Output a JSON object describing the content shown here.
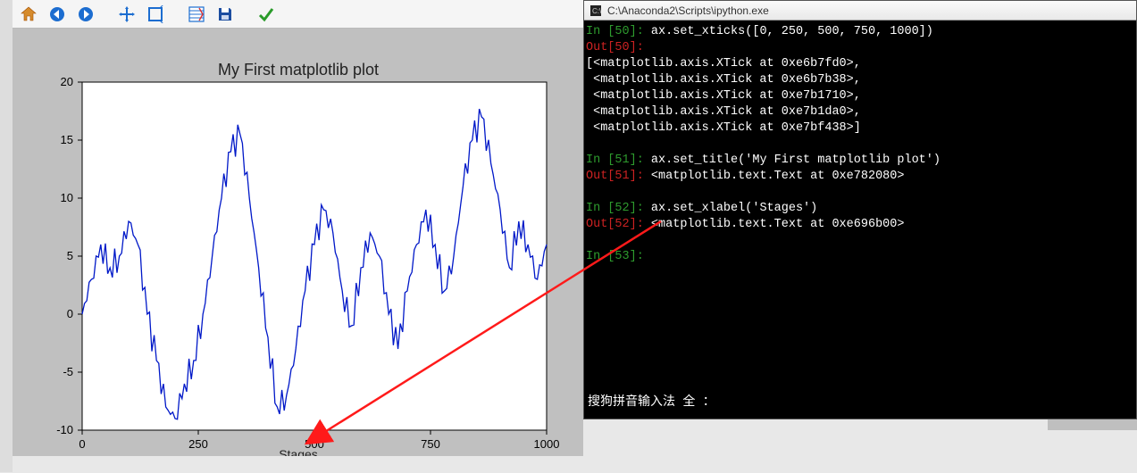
{
  "plot_window": {
    "toolbar_icons": [
      "home",
      "back",
      "forward",
      "pan",
      "zoom",
      "configure",
      "save",
      "check"
    ]
  },
  "chart_data": {
    "type": "line",
    "title": "My First matplotlib plot",
    "xlabel": "Stages",
    "ylabel": "",
    "xlim": [
      0,
      1000
    ],
    "ylim": [
      -10,
      20
    ],
    "yticks": [
      -10,
      -5,
      0,
      5,
      10,
      15,
      20
    ],
    "xticks": [
      0,
      250,
      500,
      750,
      1000
    ],
    "x": [
      0,
      20,
      40,
      60,
      80,
      100,
      120,
      140,
      160,
      180,
      200,
      220,
      240,
      260,
      280,
      300,
      320,
      340,
      360,
      380,
      400,
      420,
      440,
      460,
      480,
      500,
      520,
      540,
      560,
      580,
      600,
      620,
      640,
      660,
      680,
      700,
      720,
      740,
      760,
      780,
      800,
      820,
      840,
      860,
      880,
      900,
      920,
      940,
      960,
      980,
      1000
    ],
    "values": [
      0,
      3,
      6,
      4,
      5,
      8,
      6,
      0,
      -4,
      -8,
      -9,
      -6,
      -4,
      0,
      5,
      10,
      14,
      15.5,
      10,
      4,
      -2,
      -8,
      -7,
      -3,
      2,
      6,
      9,
      7,
      2,
      -1,
      4,
      7,
      5,
      0,
      -3,
      2,
      6,
      9,
      6,
      2,
      5,
      11,
      15,
      17,
      13,
      9,
      4,
      8,
      6,
      3,
      6
    ]
  },
  "terminal": {
    "title_path": "C:\\Anaconda2\\Scripts\\ipython.exe",
    "lines": [
      {
        "kind": "in",
        "n": "50",
        "code": "ax.set_xticks([0, 250, 500, 750, 1000])"
      },
      {
        "kind": "out",
        "n": "50",
        "code": ""
      },
      {
        "kind": "plain",
        "text": "[<matplotlib.axis.XTick at 0xe6b7fd0>,"
      },
      {
        "kind": "plain",
        "text": " <matplotlib.axis.XTick at 0xe6b7b38>,"
      },
      {
        "kind": "plain",
        "text": " <matplotlib.axis.XTick at 0xe7b1710>,"
      },
      {
        "kind": "plain",
        "text": " <matplotlib.axis.XTick at 0xe7b1da0>,"
      },
      {
        "kind": "plain",
        "text": " <matplotlib.axis.XTick at 0xe7bf438>]"
      },
      {
        "kind": "blank"
      },
      {
        "kind": "in",
        "n": "51",
        "code": "ax.set_title('My First matplotlib plot')"
      },
      {
        "kind": "out",
        "n": "51",
        "code": "<matplotlib.text.Text at 0xe782080>"
      },
      {
        "kind": "blank"
      },
      {
        "kind": "in",
        "n": "52",
        "code": "ax.set_xlabel('Stages')"
      },
      {
        "kind": "out",
        "n": "52",
        "code": "<matplotlib.text.Text at 0xe696b00>"
      },
      {
        "kind": "blank"
      },
      {
        "kind": "in",
        "n": "53",
        "code": ""
      }
    ],
    "ime_status": "搜狗拼音输入法 全 ："
  }
}
